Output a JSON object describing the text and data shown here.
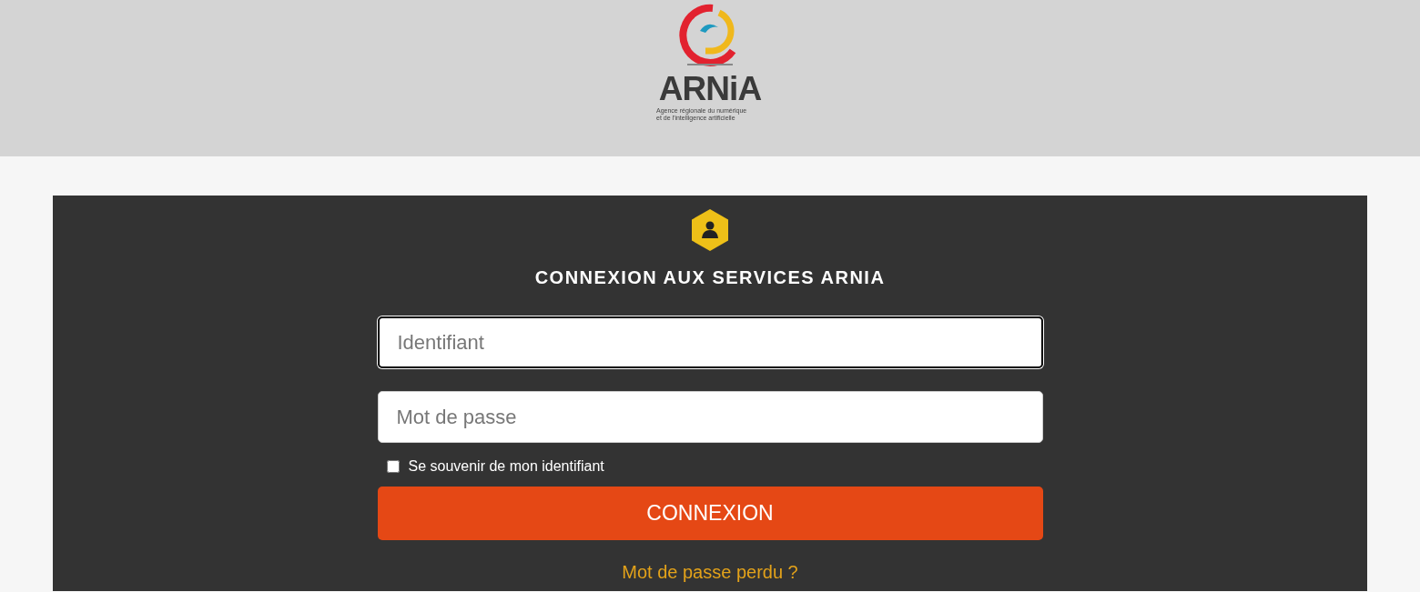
{
  "header": {
    "logo_name": "ARNiA",
    "logo_tagline": [
      "Agence régionale du numérique",
      "et de l'intelligence artificielle"
    ]
  },
  "login": {
    "title": "CONNEXION AUX SERVICES ARNIA",
    "fields": [
      {
        "placeholder": "Identifiant",
        "focused": true
      },
      {
        "placeholder": "Mot de passe",
        "focused": false
      }
    ],
    "remember": {
      "label": "Se souvenir de mon identifiant",
      "checked": false
    },
    "submit": "CONNEXION",
    "forgot_link": "Mot de passe perdu ?"
  }
}
